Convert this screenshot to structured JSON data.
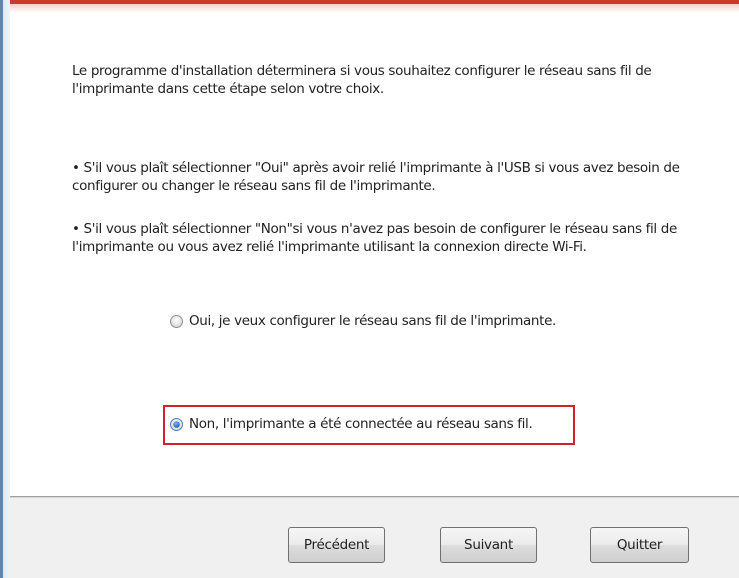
{
  "dialog": {
    "intro": "Le programme d'installation déterminera si vous souhaitez configurer le réseau sans fil de l'imprimante dans cette étape selon votre choix.",
    "bullet_oui": "• S'il vous plaît sélectionner \"Oui\" après avoir relié l'imprimante à l'USB si vous avez besoin de configurer ou changer le réseau sans fil de l'imprimante.",
    "bullet_non": "• S'il vous plaît sélectionner \"Non\"si vous n'avez pas besoin de configurer le réseau sans fil de l'imprimante ou vous avez relié l'imprimante utilisant la connexion directe Wi-Fi."
  },
  "options": {
    "oui": {
      "label": "Oui, je veux configurer le réseau sans fil de l'imprimante.",
      "selected": false
    },
    "non": {
      "label": "Non, l'imprimante a été connectée au réseau sans fil.",
      "selected": true
    }
  },
  "buttons": {
    "previous": "Précédent",
    "next": "Suivant",
    "quit": "Quitter"
  },
  "colors": {
    "highlight": "#d4202a",
    "radio_selected": "#2a6fc9"
  }
}
